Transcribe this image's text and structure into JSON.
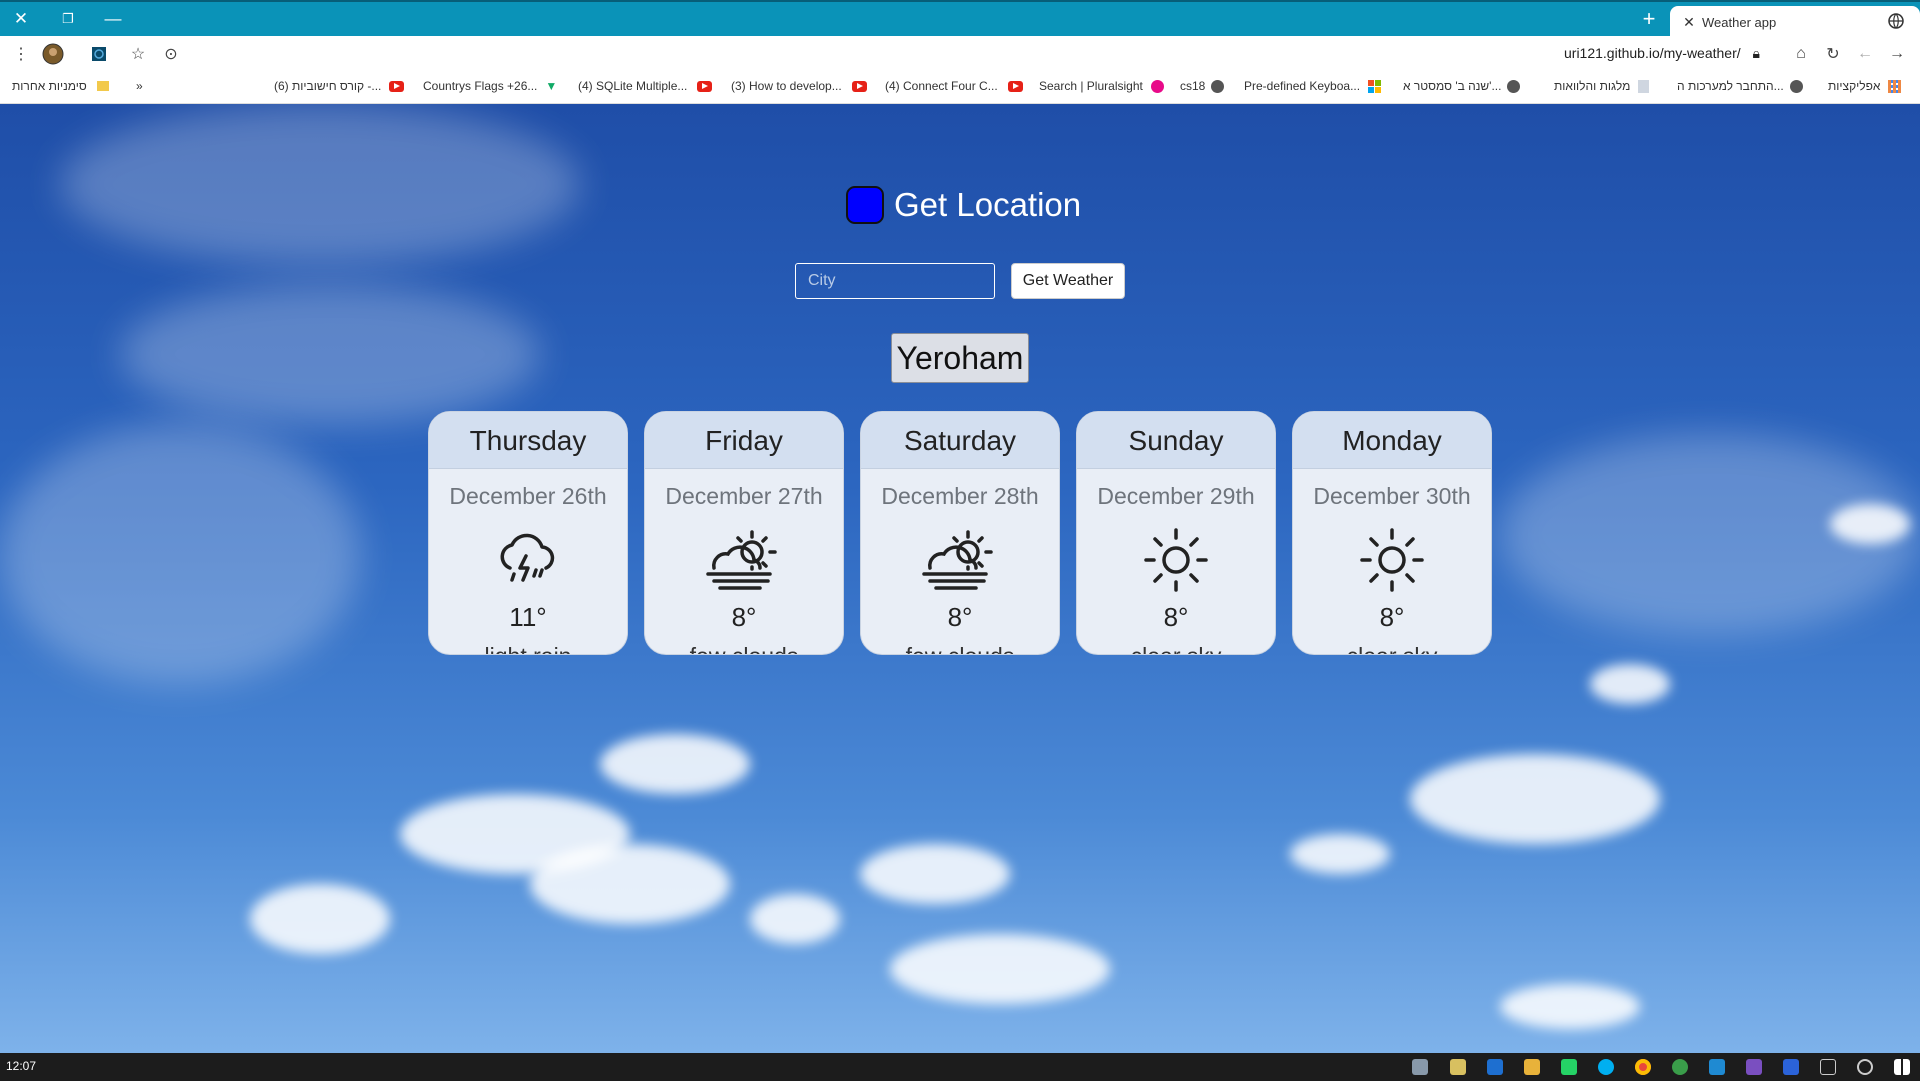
{
  "browser": {
    "tab_title": "Weather app",
    "url": "uri121.github.io/my-weather/",
    "bookmarks": {
      "apps": "אפליקציות",
      "b1": "התחבר למערכות ה...",
      "b2": "מלגות והלוואות",
      "b3": "שנה ב' סמסטר א'...",
      "b4": "Pre-defined Keyboa...",
      "b5": "cs18",
      "b6": "Search | Pluralsight",
      "b7": "(4) Connect Four C...",
      "b8": "(3) How to develop...",
      "b9": "(4) SQLite Multiple...",
      "b10": "Countrys Flags +26...",
      "b11": "(6) קורס חישוביות -...",
      "other": "סימניות אחרות",
      "more": "»"
    }
  },
  "app": {
    "get_location_label": "Get Location",
    "city_placeholder": "City",
    "get_weather_label": "Get Weather",
    "city_name": "Yeroham"
  },
  "forecast": [
    {
      "day": "Thursday",
      "date": "December 26th",
      "icon": "thunder-rain-icon",
      "temp": "11°",
      "desc": "light rain"
    },
    {
      "day": "Friday",
      "date": "December 27th",
      "icon": "few-clouds-icon",
      "temp": "8°",
      "desc": "few clouds"
    },
    {
      "day": "Saturday",
      "date": "December 28th",
      "icon": "few-clouds-icon",
      "temp": "8°",
      "desc": "few clouds"
    },
    {
      "day": "Sunday",
      "date": "December 29th",
      "icon": "clear-sky-icon",
      "temp": "8°",
      "desc": "clear sky"
    },
    {
      "day": "Monday",
      "date": "December 30th",
      "icon": "clear-sky-icon",
      "temp": "8°",
      "desc": "clear sky"
    }
  ],
  "taskbar": {
    "clock": "12:07"
  }
}
